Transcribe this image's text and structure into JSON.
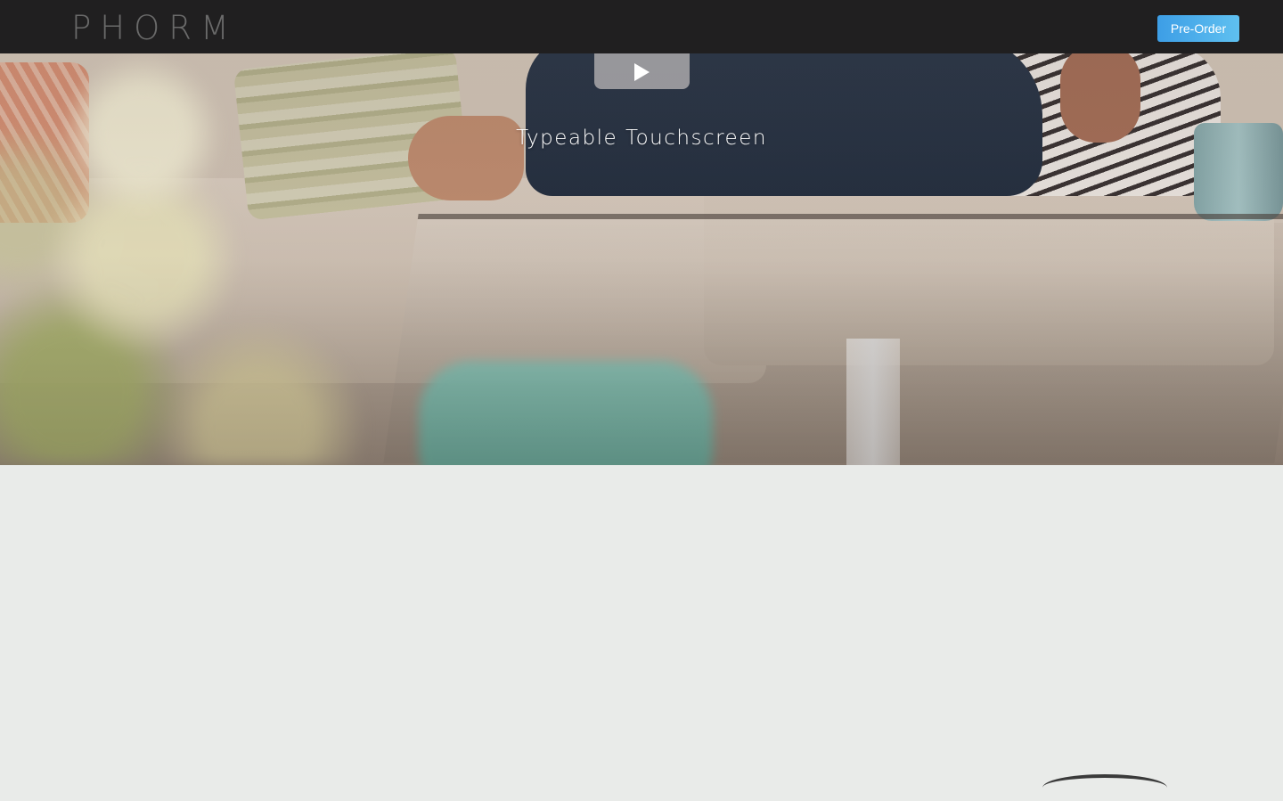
{
  "nav": {
    "logo": "PHORM",
    "preorder_label": "Pre-Order"
  },
  "hero": {
    "title": "Typeable Touchscreen",
    "play_icon": "play-icon"
  },
  "colors": {
    "topbar": "#201f20",
    "preorder_gradient_start": "#3d9ee6",
    "preorder_gradient_end": "#5fc0f0",
    "content_bg": "#e9ebe9"
  }
}
